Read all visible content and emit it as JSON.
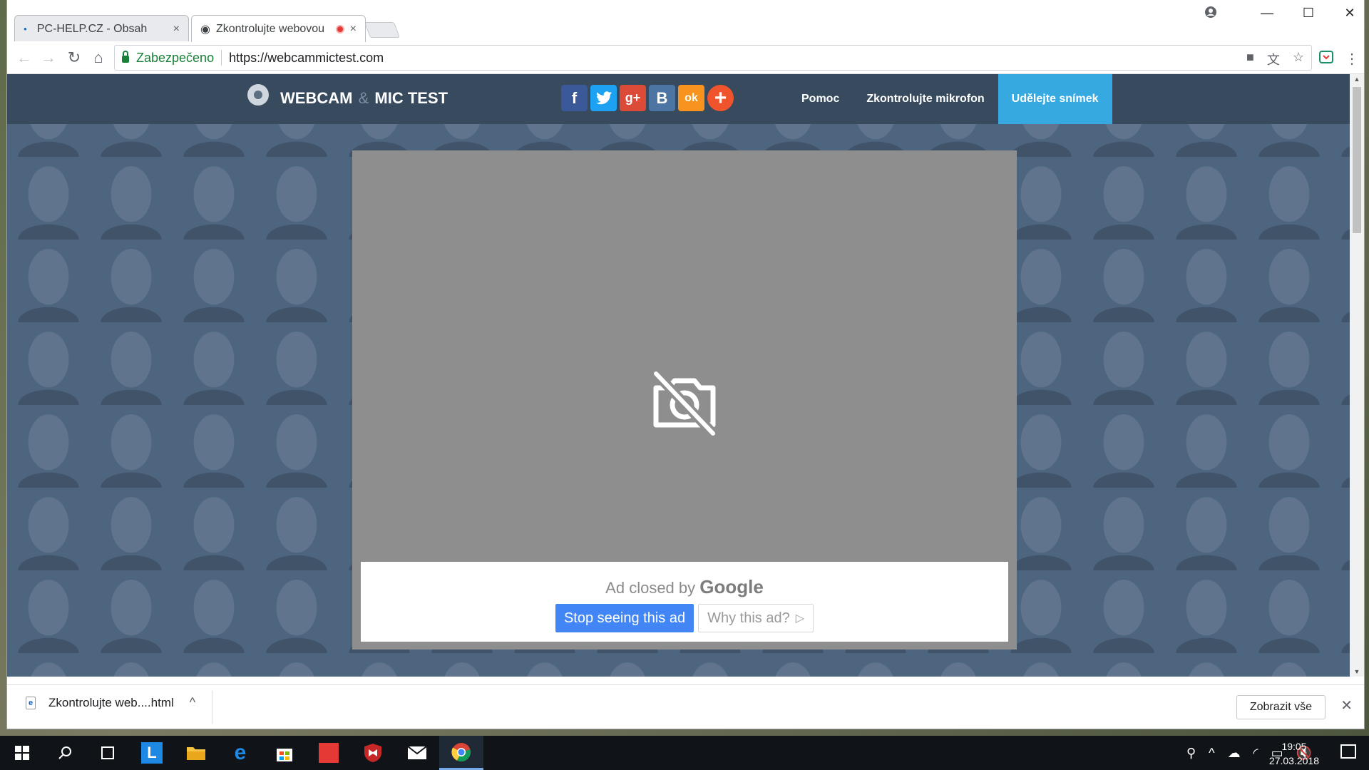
{
  "browser": {
    "tabs": [
      {
        "title": "PC-HELP.CZ - Obsah",
        "close": "×"
      },
      {
        "title": "Zkontrolujte webovou",
        "close": "×"
      }
    ],
    "window_controls": {
      "minimize": "—",
      "maximize": "☐",
      "close": "✕"
    },
    "nav": {
      "back": "←",
      "forward": "→",
      "reload": "↻",
      "home": "⌂"
    },
    "address": {
      "secure_label": "Zabezpečeno",
      "url": "https://webcammictest.com"
    },
    "omnibox_icons": [
      "camera-icon",
      "translate-icon",
      "star-icon"
    ]
  },
  "site": {
    "logo": {
      "part1": "WEBCAM",
      "amp": "&",
      "part2": "MIC TEST"
    },
    "social": [
      {
        "label": "f",
        "name": "facebook",
        "color": "#3b5998"
      },
      {
        "label": "🐦",
        "name": "twitter",
        "color": "#1da1f2"
      },
      {
        "label": "g+",
        "name": "googleplus",
        "color": "#dc4a38"
      },
      {
        "label": "B",
        "name": "vk",
        "color": "#4c75a3"
      },
      {
        "label": "ok",
        "name": "odnoklassniki",
        "color": "#f7931e"
      },
      {
        "label": "+",
        "name": "share",
        "color": "#f0542d"
      }
    ],
    "menu": [
      {
        "label": "Pomoc",
        "active": false
      },
      {
        "label": "Zkontrolujte mikrofon",
        "active": false
      },
      {
        "label": "Udělejte snímek",
        "active": true
      }
    ]
  },
  "ad": {
    "closed_text": "Ad closed by",
    "google": "Google",
    "stop_label": "Stop seeing this ad",
    "why_label": "Why this ad?",
    "why_icon": "▷"
  },
  "download_shelf": {
    "file": "Zkontrolujte web....html",
    "file_icon": "e",
    "show_all": "Zobrazit vše",
    "close": "✕"
  },
  "taskbar": {
    "time": "19:05",
    "date": "27.03.2018"
  },
  "colors": {
    "nav_bg": "#374a5e",
    "active_menu": "#36a9e1",
    "ad_button": "#4285f4"
  }
}
